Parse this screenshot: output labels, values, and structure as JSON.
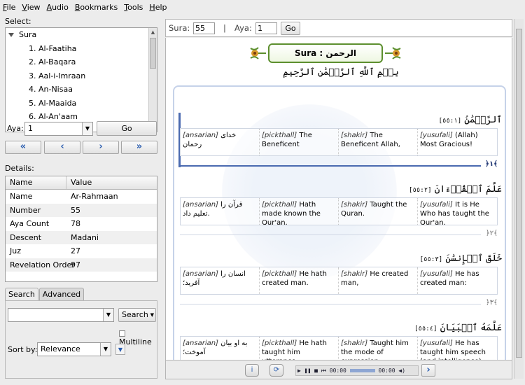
{
  "menu": [
    "File",
    "View",
    "Audio",
    "Bookmarks",
    "Tools",
    "Help"
  ],
  "select": {
    "label": "Select:",
    "root": "Sura",
    "items": [
      "1. Al-Faatiha",
      "2. Al-Baqara",
      "3. Aal-i-Imraan",
      "4. An-Nisaa",
      "5. Al-Maaida",
      "6. Al-An'aam"
    ],
    "aya_label": "Aya:",
    "aya_value": "1",
    "go": "Go",
    "nav": [
      "«",
      "‹",
      "›",
      "»"
    ]
  },
  "details": {
    "label": "Details:",
    "headers": [
      "Name",
      "Value"
    ],
    "rows": [
      [
        "Name",
        "Ar-Rahmaan"
      ],
      [
        "Number",
        "55"
      ],
      [
        "Aya Count",
        "78"
      ],
      [
        "Descent",
        "Madani"
      ],
      [
        "Juz",
        "27"
      ],
      [
        "Revelation Order",
        "97"
      ]
    ]
  },
  "search": {
    "tabs": [
      "Search",
      "Advanced"
    ],
    "query": "",
    "button": "Search",
    "multiline": "Multiline",
    "sort_label": "Sort by:",
    "sort_value": "Relevance"
  },
  "toolbar": {
    "sura_label": "Sura:",
    "sura_value": "55",
    "divider": "|",
    "aya_label": "Aya:",
    "aya_value": "1",
    "go": "Go"
  },
  "header": {
    "title": "Sura :  الرحمن",
    "bismillah": "بِسۡمِ ٱللَّهِ ٱلرَّحۡمَٰنِ ٱلرَّحِيمِ"
  },
  "ayas": [
    {
      "arabic": "ٱلرَّحۡمَٰنُ",
      "ref": "[٥٥:١]",
      "ansarian": "[ansarian] خدای رحمان",
      "pickthall": "[pickthall] The Beneficent",
      "shakir": "[shakir] The Beneficent Allah,",
      "yusufali": "[yusufali] (Allah) Most Gracious!",
      "marker": "﴿١﴾"
    },
    {
      "arabic": "عَلَّمَ ٱلۡقُرۡءَانَ",
      "ref": "[٥٥:٢]",
      "ansarian": "[ansarian] قرآن را تعلیم داد.",
      "pickthall": "[pickthall] Hath made known the Qur'an.",
      "shakir": "[shakir] Taught the Quran.",
      "yusufali": "[yusufali] It is He Who has taught the Qur'an.",
      "marker": "﴿٢﴾"
    },
    {
      "arabic": "خَلَقَ ٱلۡإِنسَٰنَ",
      "ref": "[٥٥:٣]",
      "ansarian": "[ansarian] انسان را آفرید؛",
      "pickthall": "[pickthall] He hath created man.",
      "shakir": "[shakir] He created man,",
      "yusufali": "[yusufali] He has created man:",
      "marker": "﴿٣﴾"
    },
    {
      "arabic": "عَلَّمَهُ ٱلۡبَيَانَ",
      "ref": "[٥٥:٤]",
      "ansarian": "[ansarian] به او بیان آموخت؛",
      "pickthall": "[pickthall] He hath taught him utterance.",
      "shakir": "[shakir] Taught him the mode of expression.",
      "yusufali": "[yusufali] He has taught him speech (and intelligence).",
      "marker": ""
    }
  ],
  "player": {
    "controls": "▶ ❚❚ ■ ⏮",
    "time_start": "00:00",
    "time_end": "00:00",
    "next": "›"
  },
  "colors": {
    "accent": "#2a5db0",
    "aya_rule": "#4a6ab0",
    "header_border": "#5c8f2e"
  }
}
